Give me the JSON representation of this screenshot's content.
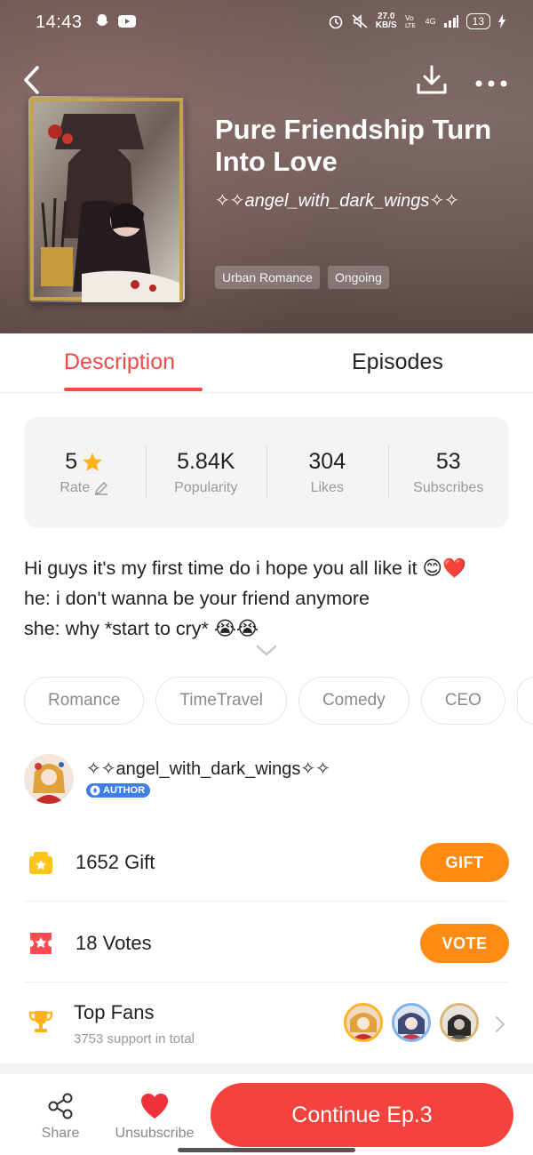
{
  "status_bar": {
    "time": "14:43",
    "net_speed_top": "27.0",
    "net_speed_bottom": "KB/S",
    "network": "4G",
    "battery": "13"
  },
  "header": {
    "title": "Pure Friendship Turn Into Love",
    "author": "✧✧angel_with_dark_wings✧✧",
    "tags": [
      "Urban Romance",
      "Ongoing"
    ]
  },
  "tabs": [
    "Description",
    "Episodes"
  ],
  "stats": [
    {
      "value": "5",
      "label": "Rate"
    },
    {
      "value": "5.84K",
      "label": "Popularity"
    },
    {
      "value": "304",
      "label": "Likes"
    },
    {
      "value": "53",
      "label": "Subscribes"
    }
  ],
  "description": {
    "lines": [
      "Hi guys it's my first time do i hope you all like it 😊❤️",
      "he: i don't wanna be your friend anymore",
      "she: why *start to cry* 😭😭"
    ]
  },
  "genres": [
    "Romance",
    "TimeTravel",
    "Comedy",
    "CEO"
  ],
  "author": {
    "name": "✧✧angel_with_dark_wings✧✧",
    "badge": "AUTHOR"
  },
  "gift": {
    "count": "1652",
    "label": "Gift",
    "button": "GIFT"
  },
  "votes": {
    "count": "18",
    "label": "Votes",
    "button": "VOTE"
  },
  "fans": {
    "title": "Top Fans",
    "subtitle": "3753 support in total"
  },
  "bottom": {
    "share": "Share",
    "unsubscribe": "Unsubscribe",
    "continue": "Continue Ep.3"
  },
  "colors": {
    "accent": "#f04a46",
    "orange": "#ff8a14",
    "continue": "#f4433e"
  }
}
